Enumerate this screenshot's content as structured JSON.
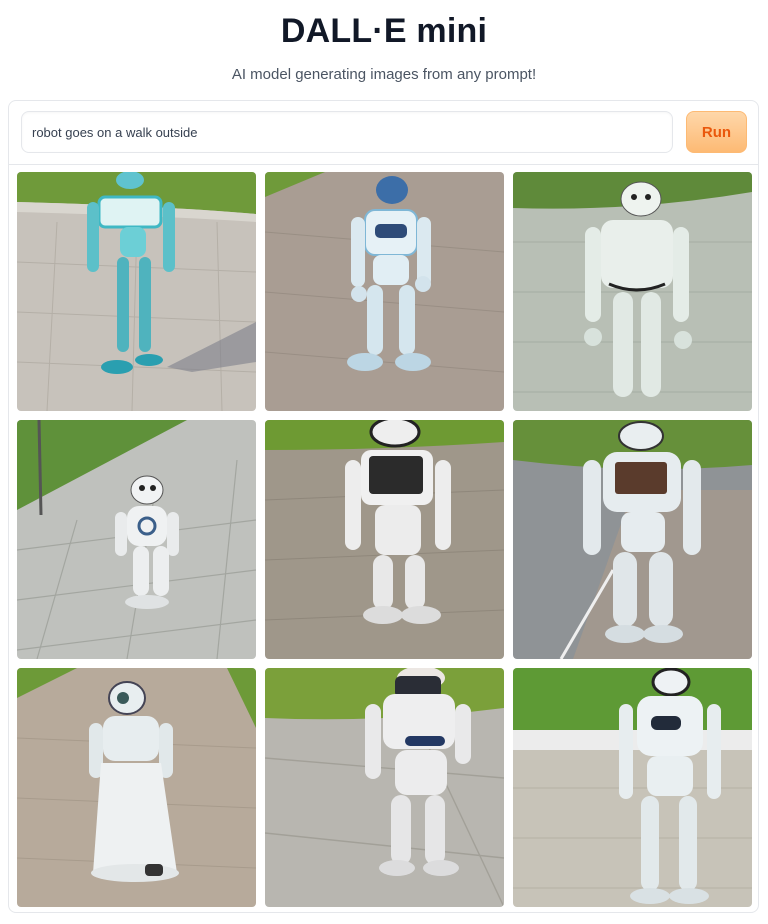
{
  "header": {
    "title": "DALL·E mini",
    "subtitle": "AI model generating images from any prompt!"
  },
  "prompt": {
    "value": "robot goes on a walk outside",
    "placeholder": ""
  },
  "run_button": {
    "label": "Run"
  },
  "colors": {
    "accent": "#ea580c",
    "accent_bg": "#fdba74",
    "title": "#111827",
    "border": "#e5e7eb"
  },
  "images": [
    {
      "scene": "brick-path",
      "robot": "teal",
      "grass": "top"
    },
    {
      "scene": "brick-path",
      "robot": "white-blue",
      "grass": "none"
    },
    {
      "scene": "stone-path",
      "robot": "white",
      "grass": "top"
    },
    {
      "scene": "tiled-sidewalk",
      "robot": "white-small",
      "grass": "left"
    },
    {
      "scene": "brick-path",
      "robot": "white-black",
      "grass": "top"
    },
    {
      "scene": "asphalt",
      "robot": "white-black",
      "grass": "top"
    },
    {
      "scene": "brick-path",
      "robot": "white-gown",
      "grass": "top"
    },
    {
      "scene": "concrete",
      "robot": "white-black",
      "grass": "top"
    },
    {
      "scene": "stone-path",
      "robot": "white-blue",
      "grass": "top"
    }
  ]
}
